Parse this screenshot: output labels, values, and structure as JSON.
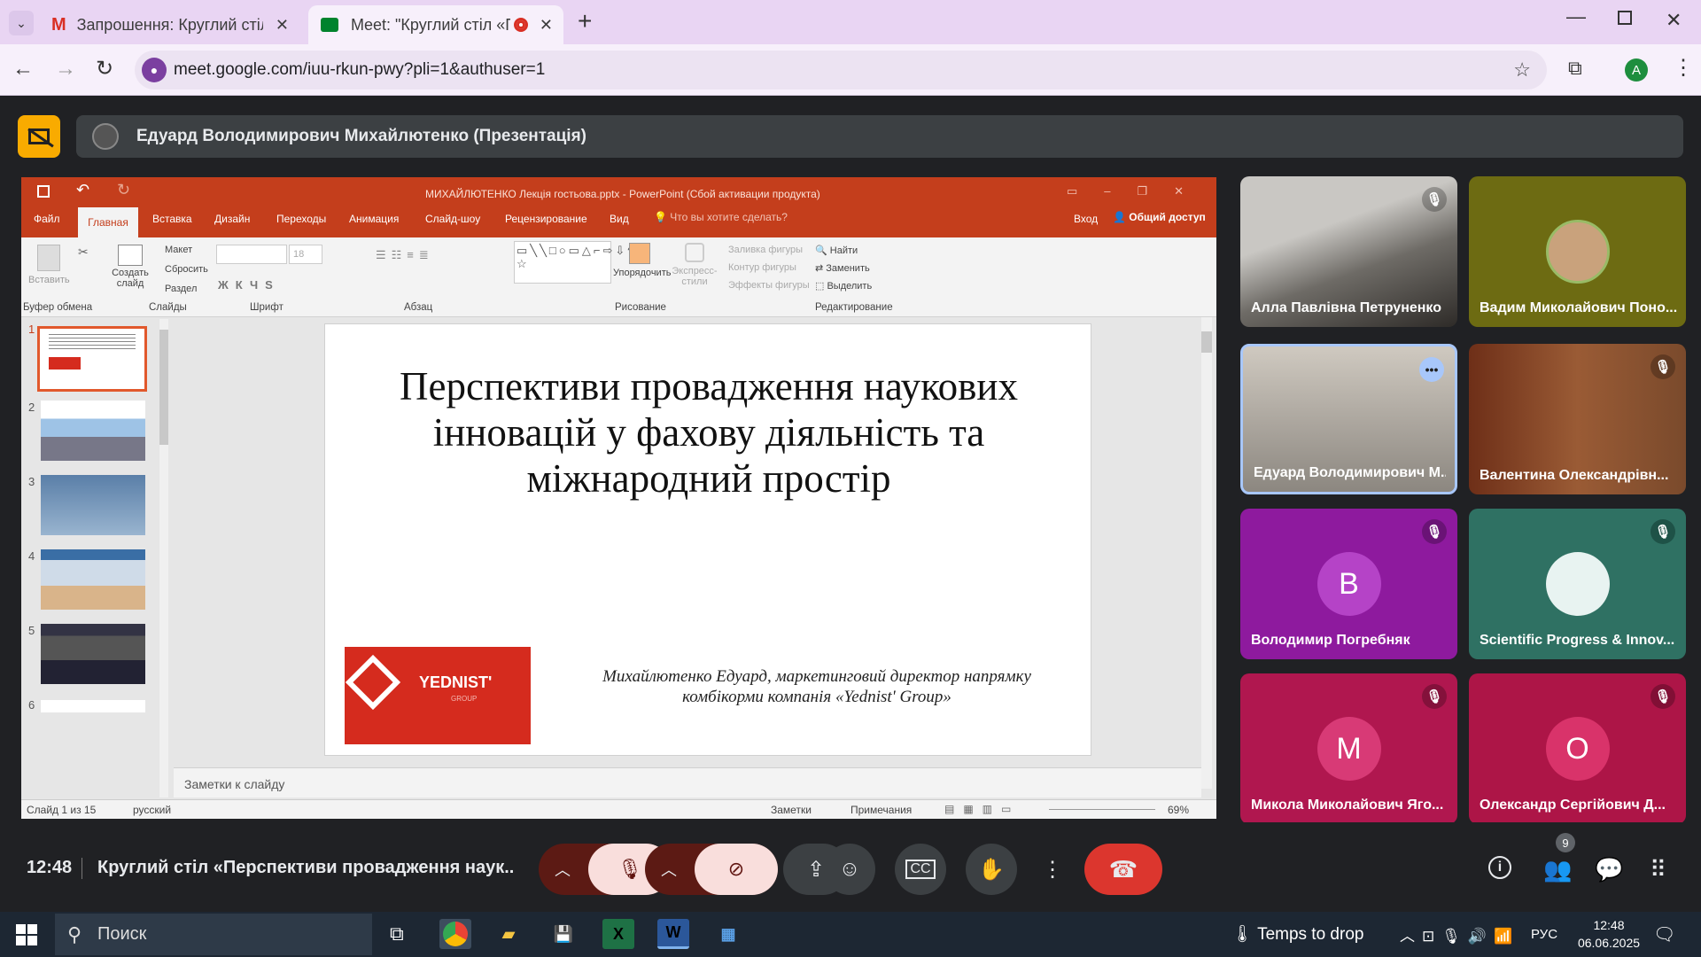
{
  "browser": {
    "tabs": [
      {
        "title": "Запрошення: Круглий стіл «Пе",
        "icon": "gmail-icon"
      },
      {
        "title": "Meet: \"Круглий стіл «Перс",
        "icon": "meet-icon"
      }
    ],
    "url": "meet.google.com/iuu-rkun-pwy?pli=1&authuser=1",
    "profile_initial": "A"
  },
  "meet": {
    "presenter_label": "Едуард Володимирович Михайлютенко (Презентація)",
    "time": "12:48",
    "meeting_title": "Круглий стіл «Перспективи провадження наук...",
    "participants_count": "9",
    "participants": [
      {
        "name": "Алла Павлівна Петруненко",
        "muted": true
      },
      {
        "name": "Вадим Миколайович Поно...",
        "muted": false
      },
      {
        "name": "Едуард Володимирович М...",
        "muted": false
      },
      {
        "name": "Валентина Олександрівн...",
        "muted": true
      },
      {
        "name": "Володимир Погребняк",
        "initial": "В",
        "muted": true
      },
      {
        "name": "Scientific Progress & Innov...",
        "muted": true
      },
      {
        "name": "Микола Миколайович Яго...",
        "initial": "M",
        "muted": true
      },
      {
        "name": "Олександр Сергійович Д...",
        "initial": "О",
        "muted": true
      }
    ]
  },
  "ppt": {
    "window_title": "МИХАЙЛЮТЕНКО Лекція гостьова.pptx - PowerPoint (Сбой активации продукта)",
    "tabs": [
      "Файл",
      "Главная",
      "Вставка",
      "Дизайн",
      "Переходы",
      "Анимация",
      "Слайд-шоу",
      "Рецензирование",
      "Вид"
    ],
    "tell_me": "Что вы хотите сделать?",
    "login": "Вход",
    "share": "Общий доступ",
    "groups": [
      "Буфер обмена",
      "Слайды",
      "Шрифт",
      "Абзац",
      "Рисование",
      "Редактирование"
    ],
    "buttons": {
      "paste": "Вставить",
      "create_slide": "Создать слайд",
      "layout": "Макет",
      "reset": "Сбросить",
      "section": "Раздел",
      "font_size": "18",
      "arrange": "Упорядочить",
      "express": "Экспресс-стили",
      "fill": "Заливка фигуры",
      "outline": "Контур фигуры",
      "effects": "Эффекты фигуры",
      "find": "Найти",
      "replace": "Заменить",
      "select": "Выделить"
    },
    "slide_numbers": [
      "1",
      "2",
      "3",
      "4",
      "5",
      "6"
    ],
    "slide": {
      "title_line1": "Перспективи провадження наукових",
      "title_line2": "інновацій у фахову діяльність та",
      "title_line3": "міжнародний простір",
      "author_line1": "Михайлютенко Едуард, маркетинговий директор напрямку",
      "author_line2": "комбікорми компанія «Yednist' Group»",
      "logo_text": "YEDNIST'",
      "logo_sub": "GROUP"
    },
    "notes": "Заметки к слайду",
    "status": {
      "slide": "Слайд 1 из 15",
      "lang": "русский",
      "notes_btn": "Заметки",
      "comments_btn": "Примечания",
      "zoom": "69%"
    }
  },
  "taskbar": {
    "search": "Поиск",
    "weather": "Temps to drop",
    "lang": "РУС",
    "time": "12:48",
    "date": "06.06.2025"
  }
}
